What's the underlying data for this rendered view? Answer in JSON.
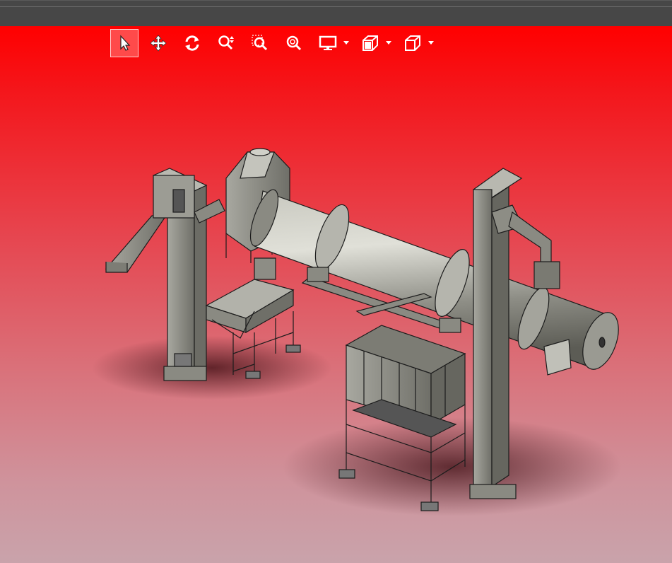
{
  "window": {
    "viewport_background_top": "#ff0000",
    "viewport_background_bottom": "#c9a3ab"
  },
  "toolbar": {
    "tools": [
      {
        "name": "select-tool",
        "icon": "cursor-arrow-icon",
        "active": true
      },
      {
        "name": "pan-tool",
        "icon": "move-arrows-icon",
        "active": false
      },
      {
        "name": "rotate-tool",
        "icon": "rotate-icon",
        "active": false
      },
      {
        "name": "zoom-tool",
        "icon": "zoom-updown-icon",
        "active": false
      },
      {
        "name": "zoom-window-tool",
        "icon": "zoom-window-icon",
        "active": false
      },
      {
        "name": "zoom-fit-tool",
        "icon": "zoom-fit-icon",
        "active": false
      },
      {
        "name": "display-mode-dropdown",
        "icon": "monitor-icon",
        "has_dropdown": true
      },
      {
        "name": "section-view-dropdown",
        "icon": "section-cube-icon",
        "has_dropdown": true
      },
      {
        "name": "view-orientation-dropdown",
        "icon": "cube-icon",
        "has_dropdown": true
      }
    ]
  },
  "model": {
    "description_icon": "rotary-dryer-plant-3d-model",
    "body_color": "#9a9a90",
    "line_color": "#1a1a1a"
  }
}
